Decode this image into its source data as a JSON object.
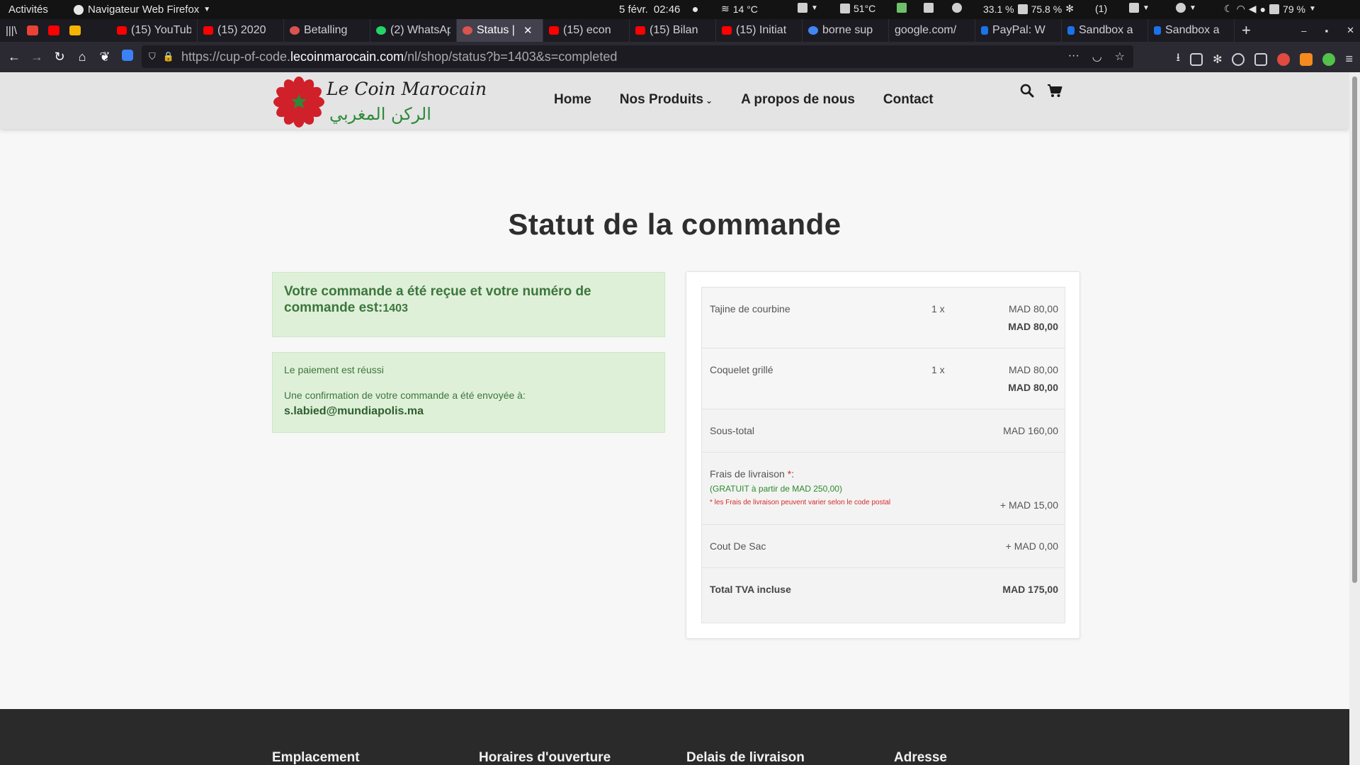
{
  "system_bar": {
    "activities": "Activités",
    "app_name": "Navigateur Web Firefox",
    "date": "5 févr.",
    "time": "02:46",
    "weather": "14 °C",
    "cpu_temp": "51°C",
    "cpu_usage": "33.1 %",
    "mem_usage": "75.8 %",
    "notification_count": "(1)",
    "battery": "79 %"
  },
  "tabs": [
    {
      "label": "(15) YouTube",
      "icon": "youtube-icon"
    },
    {
      "label": "(15) 2020",
      "icon": "youtube-icon"
    },
    {
      "label": "Betalling",
      "icon": "gear-icon"
    },
    {
      "label": "(2) WhatsApp",
      "icon": "whatsapp-icon"
    },
    {
      "label": "Status |",
      "icon": "gear-icon",
      "active": true
    },
    {
      "label": "(15) econ",
      "icon": "youtube-icon"
    },
    {
      "label": "(15) Bilan",
      "icon": "youtube-icon"
    },
    {
      "label": "(15) Initiat",
      "icon": "youtube-icon"
    },
    {
      "label": "borne sup",
      "icon": "google-icon"
    },
    {
      "label": "google.com/",
      "icon": "none"
    },
    {
      "label": "PayPal: W",
      "icon": "paypal-icon"
    },
    {
      "label": "Sandbox a",
      "icon": "paypal-icon"
    },
    {
      "label": "Sandbox a",
      "icon": "paypal-icon"
    }
  ],
  "urlbar": {
    "prefix": "https://cup-of-code.",
    "domain": "lecoinmarocain.com",
    "path": "/nl/shop/status?b=1403&s=completed"
  },
  "site": {
    "logo_script": "Le Coin Marocain",
    "logo_arabic": "الركن المغربي",
    "nav": {
      "home": "Home",
      "produits": "Nos Produits",
      "apropos": "A propos de nous",
      "contact": "Contact"
    }
  },
  "order_status": {
    "title": "Statut de la commande",
    "received_text": "Votre commande a été reçue et votre numéro de commande est:",
    "order_number": "1403",
    "payment_text": "Le paiement est réussi",
    "confirmation_text": "Une confirmation de votre commande a été envoyée à:",
    "email": "s.labied@mundiapolis.ma"
  },
  "summary": {
    "items": [
      {
        "name": "Tajine de courbine",
        "qty": "1 x",
        "unit_price": "MAD 80,00",
        "line_total": "MAD 80,00"
      },
      {
        "name": "Coquelet grillé",
        "qty": "1 x",
        "unit_price": "MAD 80,00",
        "line_total": "MAD 80,00"
      }
    ],
    "subtotal_label": "Sous-total",
    "subtotal": "MAD 160,00",
    "shipping_label": "Frais de livraison ",
    "shipping_req": "*",
    "shipping_colon": ":",
    "shipping_free_note": "(GRATUIT à partir de MAD 250,00)",
    "shipping_warning": "* les Frais de livraison peuvent varier selon le code postal",
    "shipping": "+ MAD 15,00",
    "bag_label": "Cout De Sac",
    "bag": "+ MAD 0,00",
    "total_label": "Total TVA incluse",
    "total": "MAD 175,00"
  },
  "footer": {
    "col1": "Emplacement",
    "col2": "Horaires d'ouverture",
    "col3": "Delais de livraison",
    "col4": "Adresse"
  },
  "colors": {
    "alert_bg": "#dff0d8",
    "alert_text": "#3c763d",
    "logo_red": "#d0202a",
    "logo_green": "#2c8a3a"
  }
}
